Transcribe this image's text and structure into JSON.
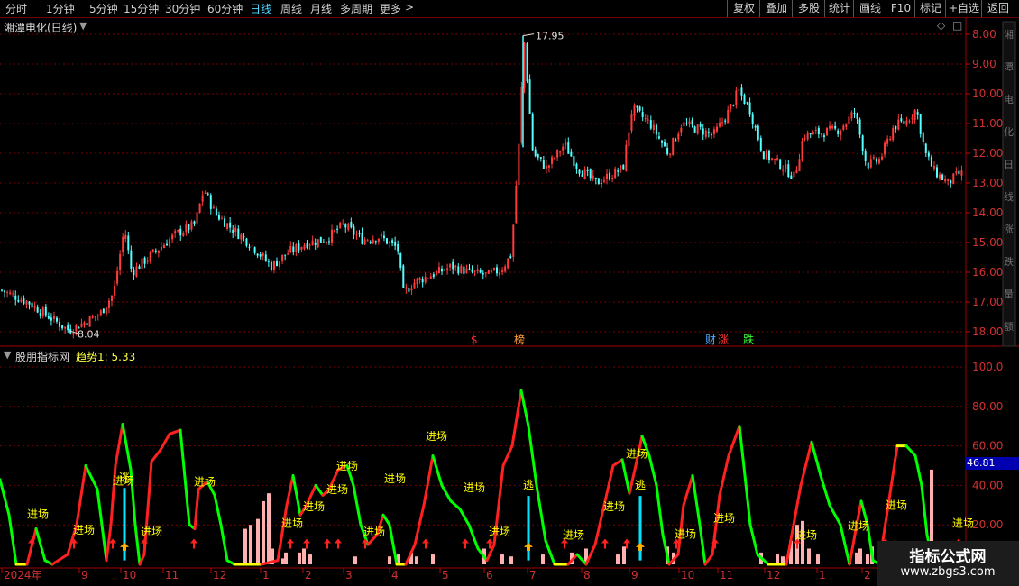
{
  "toolbar": {
    "periods": [
      "分时",
      "1分钟",
      "5分钟",
      "15分钟",
      "30分钟",
      "60分钟",
      "日线",
      "周线",
      "月线",
      "多周期",
      "更多"
    ],
    "active_period": "日线",
    "more_arrow": ">",
    "right_buttons": [
      "复权",
      "叠加",
      "多股",
      "统计",
      "画线",
      "F10",
      "标记",
      "+自选",
      "返回"
    ]
  },
  "price_panel": {
    "title": "湘潭电化(日线)",
    "high_label": "17.95",
    "low_label": "8.04",
    "y_ticks": [
      "18.00",
      "17.00",
      "16.00",
      "15.00",
      "14.00",
      "13.00",
      "12.00",
      "11.00",
      "10.00",
      "9.00",
      "8.00"
    ],
    "side_chars": [
      "湘",
      "潭",
      "电",
      "化",
      "日",
      "线",
      "涨",
      "跌",
      "量",
      "额"
    ],
    "markers": [
      {
        "text": "$",
        "color": "#ff2a2a"
      },
      {
        "text": "榜",
        "color": "#ff9a30"
      },
      {
        "text": "财",
        "color": "#4aa8ff"
      },
      {
        "text": "涨",
        "color": "#ff3030"
      },
      {
        "text": "跌",
        "color": "#3aff3a"
      }
    ]
  },
  "indicator_panel": {
    "title": "股朋指标网",
    "series_label": "趋势1: 5.33",
    "current_value": "46.81",
    "y_ticks": [
      "100.0",
      "80.00",
      "60.00",
      "40.00",
      "20.00"
    ],
    "labels": {
      "enter": "进场",
      "escape": "逃"
    }
  },
  "x_axis": {
    "labels": [
      "2024年",
      "9",
      "10",
      "11",
      "12",
      "1",
      "2",
      "3",
      "4",
      "5",
      "6",
      "7",
      "8",
      "9",
      "10",
      "11",
      "12",
      "1",
      "2"
    ]
  },
  "watermark": {
    "line1": "指标公式网",
    "line2": "www.zbgs3.com"
  },
  "colors": {
    "up": "#ff3b3b",
    "down": "#54ffff",
    "grid": "#7a0000",
    "axis_text": "#d23030",
    "trend_up": "#ff2020",
    "trend_down": "#00ff00",
    "enter": "#ffff00",
    "escape_bar": "#00e5ff",
    "volume": "#ffb0b0"
  },
  "chart_data": [
    {
      "type": "candlestick",
      "title": "湘潭电化(日线)",
      "ylim": [
        7.6,
        18.3
      ],
      "y_ticks": [
        8,
        9,
        10,
        11,
        12,
        13,
        14,
        15,
        16,
        17,
        18
      ],
      "close_path": [
        [
          0,
          9.4
        ],
        [
          30,
          9.0
        ],
        [
          75,
          8.05
        ],
        [
          85,
          8.2
        ],
        [
          110,
          8.6
        ],
        [
          125,
          9.3
        ],
        [
          137,
          11.5
        ],
        [
          145,
          10.0
        ],
        [
          175,
          10.8
        ],
        [
          195,
          11.3
        ],
        [
          215,
          11.6
        ],
        [
          225,
          12.8
        ],
        [
          237,
          12.0
        ],
        [
          255,
          11.5
        ],
        [
          275,
          11.0
        ],
        [
          300,
          10.2
        ],
        [
          320,
          10.7
        ],
        [
          340,
          11.0
        ],
        [
          360,
          11.1
        ],
        [
          380,
          11.6
        ],
        [
          400,
          11.1
        ],
        [
          420,
          11.2
        ],
        [
          440,
          10.8
        ],
        [
          446,
          9.3
        ],
        [
          460,
          9.7
        ],
        [
          485,
          10.0
        ],
        [
          500,
          10.2
        ],
        [
          520,
          10.0
        ],
        [
          540,
          9.9
        ],
        [
          555,
          10.1
        ],
        [
          566,
          10.6
        ],
        [
          575,
          14.5
        ],
        [
          580,
          17.9
        ],
        [
          590,
          14.0
        ],
        [
          605,
          13.5
        ],
        [
          625,
          14.3
        ],
        [
          640,
          13.5
        ],
        [
          660,
          13.0
        ],
        [
          690,
          13.5
        ],
        [
          700,
          15.5
        ],
        [
          720,
          15.0
        ],
        [
          740,
          14.0
        ],
        [
          755,
          15.0
        ],
        [
          775,
          14.8
        ],
        [
          790,
          14.6
        ],
        [
          805,
          15.3
        ],
        [
          818,
          16.1
        ],
        [
          830,
          15.5
        ],
        [
          845,
          14.0
        ],
        [
          865,
          13.6
        ],
        [
          880,
          13.2
        ],
        [
          890,
          14.6
        ],
        [
          910,
          14.7
        ],
        [
          930,
          14.8
        ],
        [
          947,
          15.4
        ],
        [
          960,
          13.6
        ],
        [
          975,
          13.8
        ],
        [
          990,
          14.9
        ],
        [
          1005,
          15.1
        ],
        [
          1015,
          15.5
        ],
        [
          1025,
          14.0
        ],
        [
          1035,
          13.4
        ],
        [
          1050,
          13.0
        ],
        [
          1062,
          13.3
        ]
      ],
      "high": {
        "value": 17.95,
        "label": "17.95"
      },
      "low": {
        "value": 8.04,
        "label": "8.04"
      }
    },
    {
      "type": "line",
      "title": "股朋指标网",
      "series": [
        {
          "name": "趋势1",
          "last_value": 5.33
        }
      ],
      "ylim": [
        0,
        105
      ],
      "y_ticks": [
        20,
        40,
        60,
        80,
        100
      ],
      "trend_path": [
        [
          0,
          43
        ],
        [
          10,
          25
        ],
        [
          18,
          0
        ],
        [
          30,
          0
        ],
        [
          40,
          18
        ],
        [
          50,
          2
        ],
        [
          58,
          0
        ],
        [
          75,
          5
        ],
        [
          85,
          20
        ],
        [
          95,
          50
        ],
        [
          108,
          38
        ],
        [
          118,
          2
        ],
        [
          123,
          20
        ],
        [
          128,
          50
        ],
        [
          136,
          71
        ],
        [
          145,
          48
        ],
        [
          150,
          20
        ],
        [
          155,
          0
        ],
        [
          160,
          5
        ],
        [
          168,
          52
        ],
        [
          178,
          58
        ],
        [
          188,
          66
        ],
        [
          200,
          68
        ],
        [
          210,
          20
        ],
        [
          216,
          18
        ],
        [
          220,
          38
        ],
        [
          230,
          42
        ],
        [
          238,
          35
        ],
        [
          245,
          20
        ],
        [
          252,
          2
        ],
        [
          260,
          0
        ],
        [
          275,
          0
        ],
        [
          290,
          0
        ],
        [
          308,
          2
        ],
        [
          318,
          30
        ],
        [
          325,
          45
        ],
        [
          333,
          25
        ],
        [
          340,
          30
        ],
        [
          350,
          40
        ],
        [
          358,
          35
        ],
        [
          365,
          38
        ],
        [
          375,
          48
        ],
        [
          385,
          50
        ],
        [
          392,
          40
        ],
        [
          400,
          20
        ],
        [
          408,
          10
        ],
        [
          418,
          15
        ],
        [
          425,
          25
        ],
        [
          432,
          20
        ],
        [
          440,
          0
        ],
        [
          450,
          0
        ],
        [
          460,
          10
        ],
        [
          470,
          30
        ],
        [
          480,
          55
        ],
        [
          490,
          40
        ],
        [
          500,
          32
        ],
        [
          510,
          28
        ],
        [
          520,
          20
        ],
        [
          530,
          8
        ],
        [
          540,
          2
        ],
        [
          548,
          10
        ],
        [
          558,
          50
        ],
        [
          568,
          60
        ],
        [
          578,
          88
        ],
        [
          586,
          70
        ],
        [
          595,
          40
        ],
        [
          605,
          12
        ],
        [
          615,
          0
        ],
        [
          630,
          0
        ],
        [
          640,
          5
        ],
        [
          650,
          0
        ],
        [
          660,
          10
        ],
        [
          670,
          30
        ],
        [
          680,
          50
        ],
        [
          690,
          53
        ],
        [
          698,
          36
        ],
        [
          705,
          50
        ],
        [
          712,
          65
        ],
        [
          720,
          55
        ],
        [
          728,
          40
        ],
        [
          735,
          15
        ],
        [
          742,
          0
        ],
        [
          752,
          5
        ],
        [
          758,
          30
        ],
        [
          768,
          45
        ],
        [
          776,
          20
        ],
        [
          782,
          0
        ],
        [
          790,
          5
        ],
        [
          798,
          35
        ],
        [
          808,
          55
        ],
        [
          820,
          70
        ],
        [
          826,
          45
        ],
        [
          832,
          20
        ],
        [
          840,
          5
        ],
        [
          852,
          0
        ],
        [
          872,
          0
        ],
        [
          880,
          20
        ],
        [
          888,
          40
        ],
        [
          900,
          62
        ],
        [
          910,
          45
        ],
        [
          920,
          30
        ],
        [
          932,
          20
        ],
        [
          942,
          0
        ],
        [
          948,
          15
        ],
        [
          955,
          32
        ],
        [
          962,
          20
        ],
        [
          968,
          2
        ],
        [
          975,
          0
        ],
        [
          985,
          30
        ],
        [
          995,
          60
        ],
        [
          1005,
          60
        ],
        [
          1015,
          55
        ],
        [
          1022,
          40
        ],
        [
          1028,
          15
        ],
        [
          1035,
          0
        ]
      ],
      "enter_signals": [
        [
          42,
          23.5
        ],
        [
          93,
          15.5
        ],
        [
          137,
          40.5
        ],
        [
          168,
          14.5
        ],
        [
          227,
          40
        ],
        [
          324,
          19
        ],
        [
          348,
          27.5
        ],
        [
          374,
          36
        ],
        [
          385,
          48
        ],
        [
          415,
          14.5
        ],
        [
          438,
          41.5
        ],
        [
          484,
          63
        ],
        [
          526,
          37
        ],
        [
          554,
          14.5
        ],
        [
          636,
          13
        ],
        [
          681,
          27.5
        ],
        [
          706,
          54
        ],
        [
          760,
          13.5
        ],
        [
          803,
          21.5
        ],
        [
          894,
          13
        ],
        [
          952,
          17.5
        ],
        [
          994,
          28
        ],
        [
          1068,
          19
        ]
      ],
      "escape_signals": [
        [
          138,
          40.5
        ],
        [
          586,
          36.5
        ],
        [
          710,
          36.5
        ]
      ],
      "up_arrows": [
        35,
        82,
        125,
        160,
        215,
        322,
        340,
        363,
        375,
        405,
        472,
        516,
        543,
        626,
        671,
        695,
        750,
        793,
        884,
        982,
        1063
      ],
      "volume_bars": [
        [
          270,
          18
        ],
        [
          276,
          20
        ],
        [
          284,
          23
        ],
        [
          290,
          32
        ],
        [
          296,
          36
        ],
        [
          300,
          8
        ],
        [
          312,
          3
        ],
        [
          315,
          6
        ],
        [
          330,
          6
        ],
        [
          335,
          8
        ],
        [
          342,
          5
        ],
        [
          392,
          4
        ],
        [
          430,
          4
        ],
        [
          440,
          5
        ],
        [
          454,
          6
        ],
        [
          460,
          4
        ],
        [
          478,
          5
        ],
        [
          535,
          8
        ],
        [
          555,
          5
        ],
        [
          565,
          4
        ],
        [
          600,
          5
        ],
        [
          632,
          6
        ],
        [
          648,
          8
        ],
        [
          683,
          5
        ],
        [
          690,
          9
        ],
        [
          738,
          9
        ],
        [
          745,
          6
        ],
        [
          842,
          6
        ],
        [
          860,
          5
        ],
        [
          866,
          4
        ],
        [
          875,
          12
        ],
        [
          882,
          20
        ],
        [
          888,
          22
        ],
        [
          895,
          8
        ],
        [
          905,
          5
        ],
        [
          940,
          4
        ],
        [
          948,
          6
        ],
        [
          952,
          8
        ],
        [
          960,
          5
        ],
        [
          965,
          9
        ],
        [
          990,
          3
        ],
        [
          1025,
          5
        ],
        [
          1031,
          48
        ]
      ]
    }
  ]
}
